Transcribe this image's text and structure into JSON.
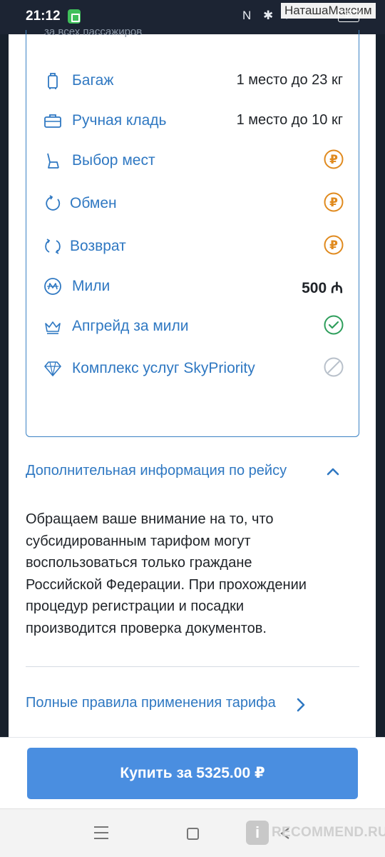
{
  "status_bar": {
    "time": "21:12",
    "user_name": "НаташаМаксим",
    "battery": "95"
  },
  "fare_card": {
    "caption": "за всех пассажиров",
    "rows": [
      {
        "icon": "suitcase-icon",
        "label": "Багаж",
        "value": "1 место до 23 кг"
      },
      {
        "icon": "briefcase-icon",
        "label": "Ручная кладь",
        "value": "1 место до 10 кг"
      },
      {
        "icon": "seat-icon",
        "label": "Выбор мест",
        "status": "paid",
        "status_symbol": "₽"
      },
      {
        "icon": "exchange-icon",
        "label": "Обмен",
        "status": "paid",
        "status_symbol": "₽"
      },
      {
        "icon": "refund-icon",
        "label": "Возврат",
        "status": "paid",
        "status_symbol": "₽"
      },
      {
        "icon": "miles-icon",
        "label": "Мили",
        "value": "500 ₼"
      },
      {
        "icon": "crown-icon",
        "label": "Апгрейд за мили",
        "status": "included"
      },
      {
        "icon": "diamond-icon",
        "label": "Комплекс услуг SkyPriority",
        "status": "unavailable"
      }
    ]
  },
  "additional_info": {
    "title": "Дополнительная информация по рейсу",
    "expanded": true,
    "lines": [
      "Обращаем ваше внимание на то, что",
      "субсидированным тарифом могут",
      "воспользоваться только граждане",
      "Российской Федерации. При прохождении",
      "процедур регистрации и посадки",
      "производится проверка документов."
    ]
  },
  "rules_link": {
    "label": "Полные правила применения тарифа"
  },
  "buy_button": {
    "label": "Купить за 5325.00 ₽"
  },
  "watermark": {
    "badge": "i",
    "text": "RECOMMEND.RU"
  },
  "colors": {
    "accent": "#2f78c2",
    "button": "#4a8ee0",
    "paid": "#e08a1e",
    "included": "#2e9e5b",
    "unavailable": "#b8c0ca"
  }
}
